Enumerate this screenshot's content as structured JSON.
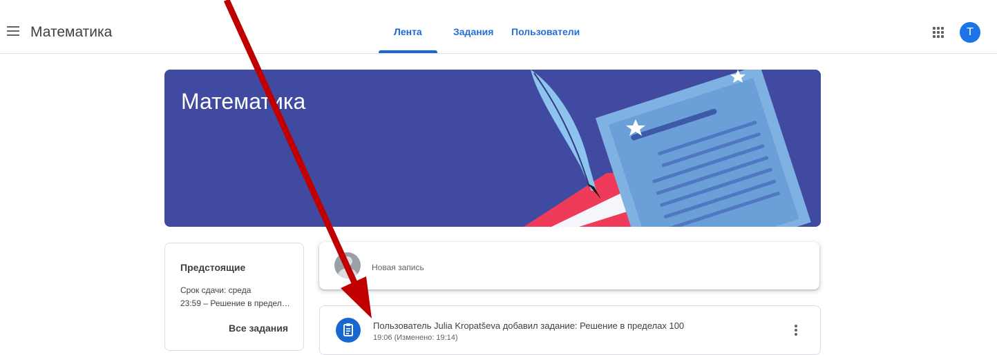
{
  "header": {
    "app_title": "Математика",
    "menu_icon": "hamburger-menu-icon",
    "tabs": [
      {
        "label": "Лента",
        "active": true
      },
      {
        "label": "Задания",
        "active": false
      },
      {
        "label": "Пользователи",
        "active": false
      }
    ],
    "apps_icon": "google-apps-grid-icon",
    "avatar_letter": "T",
    "accent_color": "#1967d2"
  },
  "banner": {
    "title": "Математика",
    "background_color": "#3f4aa0"
  },
  "upcoming": {
    "title": "Предстоящие",
    "due": "Срок сдачи: среда",
    "item": "23:59 – Решение в пределах 100",
    "link": "Все задания"
  },
  "new_post": {
    "placeholder": "Новая запись"
  },
  "post": {
    "icon": "assignment-icon",
    "title": "Пользователь Julia Kropatševa добавил задание: Решение в пределах 100",
    "time": "19:06 (Изменено: 19:14)",
    "more_icon": "more-vert-icon"
  },
  "annotation": {
    "arrow_color": "#c00000"
  }
}
